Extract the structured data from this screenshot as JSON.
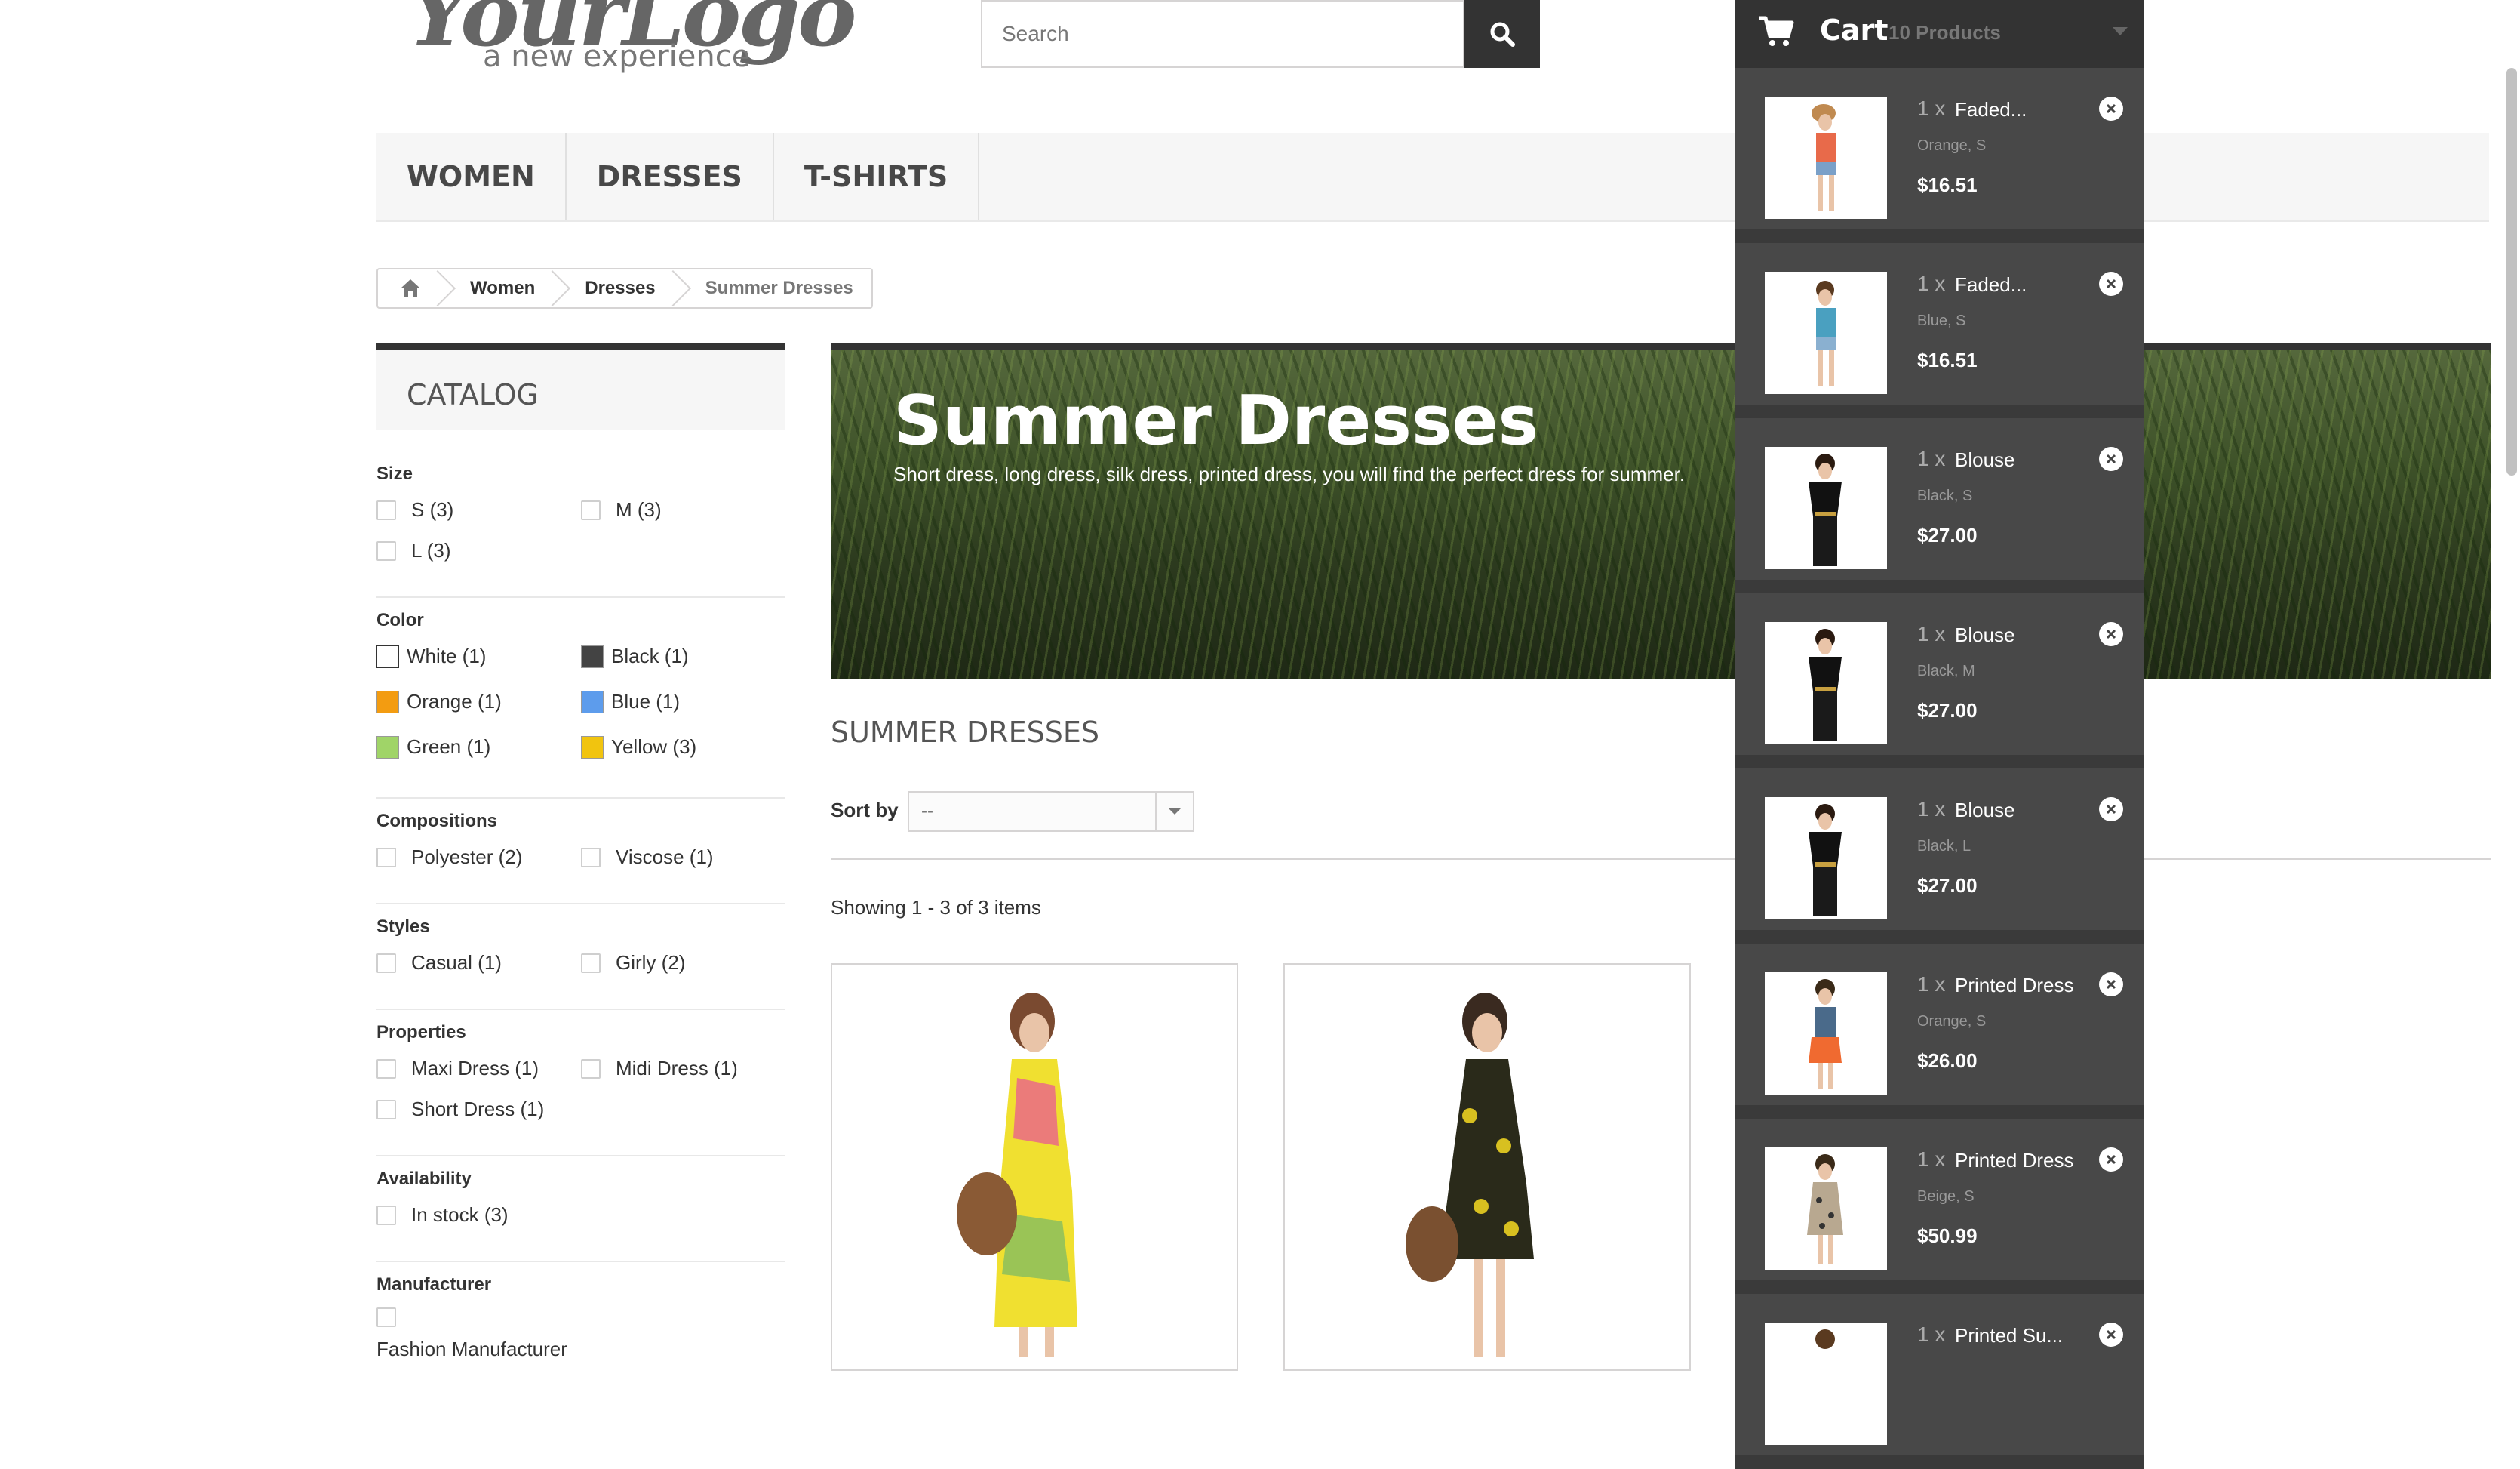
{
  "logo": {
    "text": "YourLogo",
    "tagline": "a new experience"
  },
  "search": {
    "placeholder": "Search",
    "value": ""
  },
  "nav": [
    "WOMEN",
    "DRESSES",
    "T-SHIRTS"
  ],
  "breadcrumb": [
    "Women",
    "Dresses",
    "Summer Dresses"
  ],
  "sidebar": {
    "catalog_title": "CATALOG",
    "size": {
      "title": "Size",
      "options": [
        "S (3)",
        "M (3)",
        "L (3)"
      ]
    },
    "color": {
      "title": "Color",
      "options": [
        {
          "label": "White (1)",
          "color": "#ffffff"
        },
        {
          "label": "Black (1)",
          "color": "#434343"
        },
        {
          "label": "Orange (1)",
          "color": "#f39c11"
        },
        {
          "label": "Blue (1)",
          "color": "#5d9cec"
        },
        {
          "label": "Green (1)",
          "color": "#a0d468"
        },
        {
          "label": "Yellow (3)",
          "color": "#f1c40f"
        }
      ]
    },
    "compositions": {
      "title": "Compositions",
      "options": [
        "Polyester (2)",
        "Viscose (1)"
      ]
    },
    "styles": {
      "title": "Styles",
      "options": [
        "Casual (1)",
        "Girly (2)"
      ]
    },
    "properties": {
      "title": "Properties",
      "options": [
        "Maxi Dress (1)",
        "Midi Dress (1)",
        "Short Dress (1)"
      ]
    },
    "availability": {
      "title": "Availability",
      "options": [
        "In stock (3)"
      ]
    },
    "manufacturer": {
      "title": "Manufacturer",
      "options": [
        "Fashion Manufacturer"
      ]
    }
  },
  "banner": {
    "title": "Summer Dresses",
    "description": "Short dress, long dress, silk dress, printed dress, you will find the perfect dress for summer."
  },
  "category_heading": "SUMMER DRESSES",
  "sort": {
    "label": "Sort by",
    "value": "--"
  },
  "showing": "Showing 1 - 3 of 3 items",
  "cart": {
    "label": "Cart",
    "count": "10 Products",
    "items": [
      {
        "qty": "1 x",
        "name": "Faded...",
        "attr": "Orange, S",
        "price": "$16.51"
      },
      {
        "qty": "1 x",
        "name": "Faded...",
        "attr": "Blue, S",
        "price": "$16.51"
      },
      {
        "qty": "1 x",
        "name": "Blouse",
        "attr": "Black, S",
        "price": "$27.00"
      },
      {
        "qty": "1 x",
        "name": "Blouse",
        "attr": "Black, M",
        "price": "$27.00"
      },
      {
        "qty": "1 x",
        "name": "Blouse",
        "attr": "Black, L",
        "price": "$27.00"
      },
      {
        "qty": "1 x",
        "name": "Printed Dress",
        "attr": "Orange, S",
        "price": "$26.00"
      },
      {
        "qty": "1 x",
        "name": "Printed Dress",
        "attr": "Beige, S",
        "price": "$50.99"
      },
      {
        "qty": "1 x",
        "name": "Printed Su...",
        "attr": "",
        "price": ""
      }
    ]
  },
  "colors": {
    "dark": "#333333",
    "cart_bg": "#484848",
    "nav_bg": "#f6f6f6"
  }
}
